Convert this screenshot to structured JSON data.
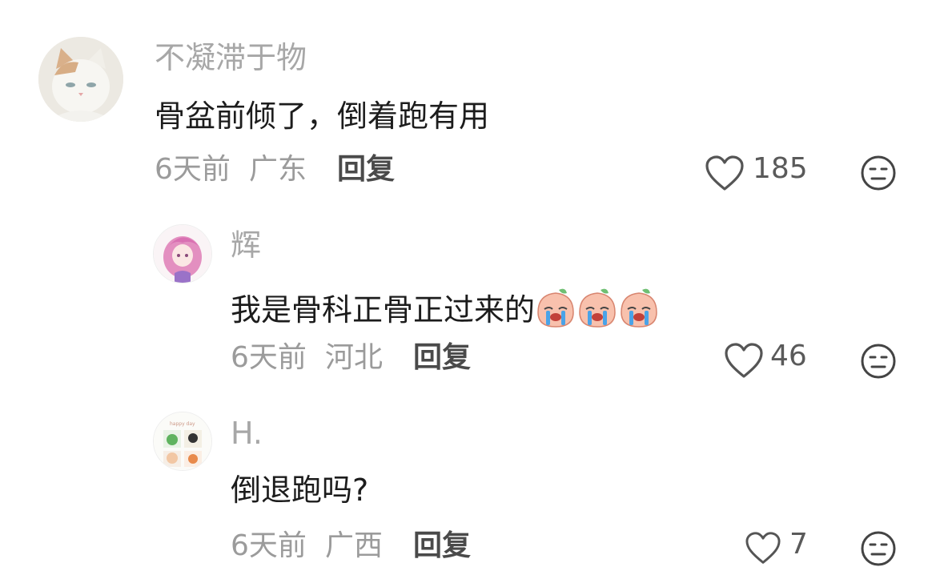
{
  "comments": [
    {
      "username": "不凝滞于物",
      "text": "骨盆前倾了，倒着跑有用",
      "time": "6天前",
      "location": "广东",
      "reply_label": "回复",
      "likes": "185",
      "avatar_icon": "white-cat-avatar"
    },
    {
      "username": "辉",
      "text": "我是骨科正骨正过来的",
      "emojis": [
        "crying-peach-emoji",
        "crying-peach-emoji",
        "crying-peach-emoji"
      ],
      "time": "6天前",
      "location": "河北",
      "reply_label": "回复",
      "likes": "46",
      "avatar_icon": "anime-girl-avatar"
    },
    {
      "username": "H.",
      "text": "倒退跑吗?",
      "time": "6天前",
      "location": "广西",
      "reply_label": "回复",
      "likes": "7",
      "avatar_icon": "cartoon-grid-avatar"
    }
  ],
  "colors": {
    "username": "#a7a7a7",
    "text": "#1c1c1c",
    "meta": "#9b9b9b",
    "reply": "#4a4a4a"
  }
}
